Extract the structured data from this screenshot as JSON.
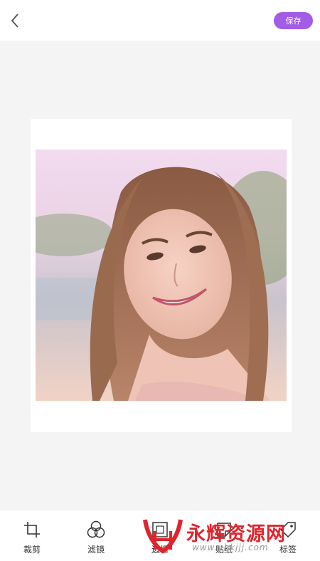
{
  "header": {
    "back_icon": "chevron-left-icon",
    "save_label": "保存",
    "save_color": "#a25ce6"
  },
  "editor": {
    "photo_description": "portrait photo of smiling woman with long brown hair"
  },
  "toolbar": {
    "items": [
      {
        "label": "裁剪",
        "icon": "crop-icon"
      },
      {
        "label": "滤镜",
        "icon": "filter-icon"
      },
      {
        "label": "边框",
        "icon": "frame-icon"
      },
      {
        "label": "贴纸",
        "icon": "sticker-icon"
      },
      {
        "label": "标签",
        "icon": "tag-icon"
      }
    ]
  },
  "watermark": {
    "text": "永辉资源网",
    "url": "www.yhkjjj.com",
    "color": "#e0242c"
  }
}
